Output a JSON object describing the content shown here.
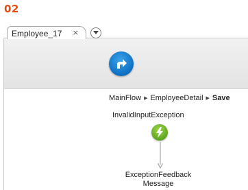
{
  "step_number": "02",
  "tabs": [
    {
      "label": "Employee_17",
      "close_glyph": "×",
      "active": true
    }
  ],
  "tab_menu_icon": "chevron-down-icon",
  "toolbar": {
    "action_icon": "redirect-arrow-icon",
    "action_color": "#0d6fc2"
  },
  "breadcrumb": {
    "items": [
      "MainFlow",
      "EmployeeDetail",
      "Save"
    ],
    "separator": "▶"
  },
  "flow": {
    "exception_handler": {
      "label": "InvalidInputException",
      "icon": "lightning-icon",
      "color": "#5ea51f"
    },
    "target": {
      "line1": "ExceptionFeedback",
      "line2": "Message"
    }
  },
  "colors": {
    "accent": "#e8490f"
  }
}
